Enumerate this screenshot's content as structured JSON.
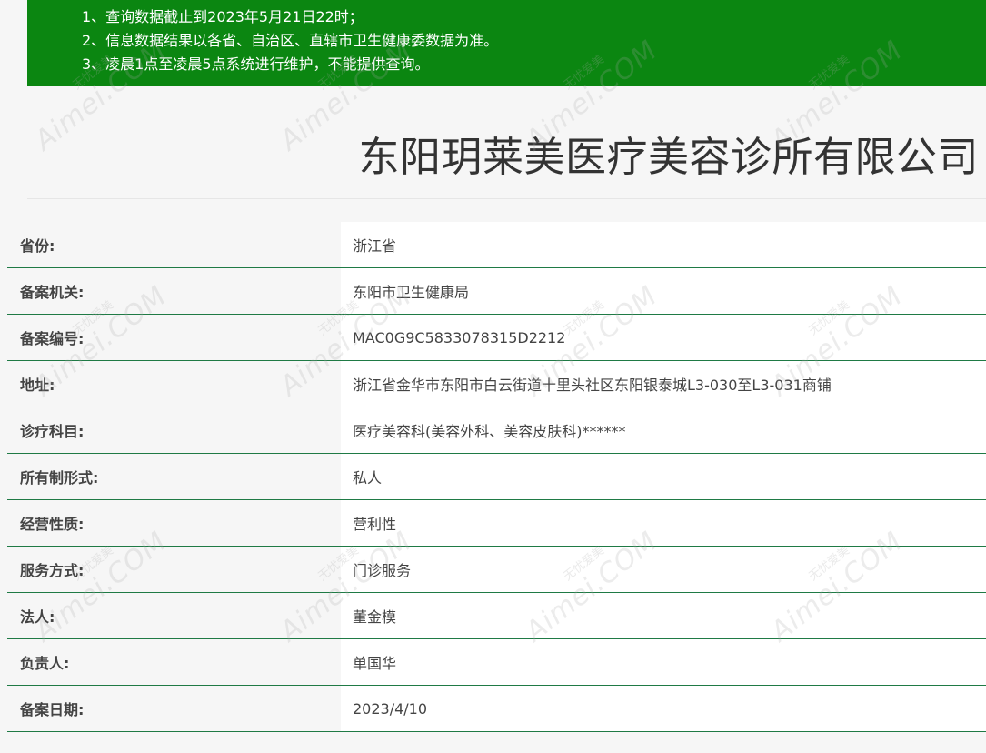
{
  "notice": {
    "lines": [
      "1、查询数据截止到2023年5月21日22时；",
      "2、信息数据结果以各省、自治区、直辖市卫生健康委数据为准。",
      "3、凌晨1点至凌晨5点系统进行维护，不能提供查询。"
    ],
    "background_color": "#0b8611"
  },
  "title": "东阳玥莱美医疗美容诊所有限公司",
  "rows": [
    {
      "label": "省份:",
      "value": "浙江省"
    },
    {
      "label": "备案机关:",
      "value": "东阳市卫生健康局"
    },
    {
      "label": "备案编号:",
      "value": "MAC0G9C5833078315D2212"
    },
    {
      "label": "地址:",
      "value": "浙江省金华市东阳市白云街道十里头社区东阳银泰城L3-030至L3-031商铺"
    },
    {
      "label": "诊疗科目:",
      "value": "医疗美容科(美容外科、美容皮肤科)******"
    },
    {
      "label": "所有制形式:",
      "value": "私人"
    },
    {
      "label": "经营性质:",
      "value": "营利性"
    },
    {
      "label": "服务方式:",
      "value": "门诊服务"
    },
    {
      "label": "法人:",
      "value": "董金模"
    },
    {
      "label": "负责人:",
      "value": "单国华"
    },
    {
      "label": "备案日期:",
      "value": "2023/4/10"
    }
  ],
  "watermark": {
    "main": "Aimei.COM",
    "sub": "无忧爱美"
  }
}
